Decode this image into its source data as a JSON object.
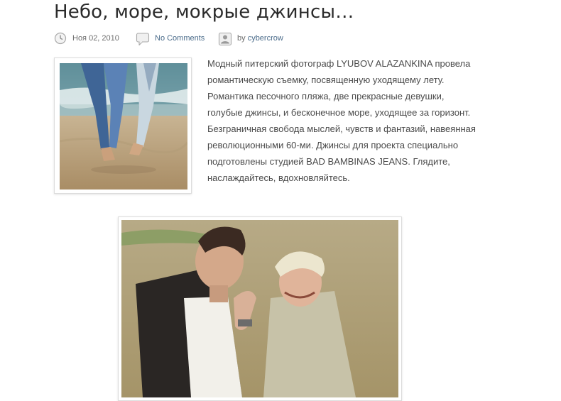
{
  "post": {
    "title": "Небо, море, мокрые джинсы…",
    "meta": {
      "date": "Ноя 02, 2010",
      "comments": "No Comments",
      "author_prefix": "by",
      "author": "cybercrow"
    },
    "excerpt": "Модный питерский фотограф LYUBOV ALAZANKINA провела романтическую съемку, посвященную уходящему лету. Романтика песочного пляжа, две прекрасные девушки, голубые джинсы, и бесконечное море, уходящее за горизонт. Безграничная свобода мыслей, чувств и фантазий, навеянная революционными 60-ми. Джинсы для проекта специально подготовлены студией BAD BAMBINAS JEANS. Глядите, наслаждайтесь, вдохновляйтесь."
  },
  "icons": {
    "date": "clock-icon",
    "comments": "speech-bubble-icon",
    "author": "user-icon"
  },
  "colors": {
    "title": "#2b2b2b",
    "text": "#4a4a4a",
    "meta": "#6e6e6e",
    "link": "#4a6b8a",
    "frame_border": "#dcdcdc"
  }
}
